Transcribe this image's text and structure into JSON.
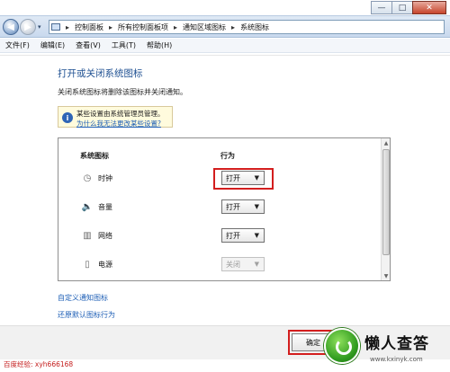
{
  "window": {
    "controls": [
      "—",
      "□",
      "✕"
    ]
  },
  "nav": {
    "address_segments": [
      "控制面板",
      "所有控制面板项",
      "通知区域图标",
      "系统图标"
    ],
    "separator": "▸"
  },
  "menu": {
    "items": [
      "文件(F)",
      "编辑(E)",
      "查看(V)",
      "工具(T)",
      "帮助(H)"
    ]
  },
  "page": {
    "title": "打开或关闭系统图标",
    "description": "关闭系统图标将删除该图标并关闭通知。",
    "notice": {
      "text": "某些设置由系统管理员管理。",
      "link": "为什么我无法更改某些设置?"
    },
    "table": {
      "col_icon": "系统图标",
      "col_behavior": "行为",
      "rows": [
        {
          "icon": "clock-icon",
          "label": "时钟",
          "value": "打开",
          "enabled": true
        },
        {
          "icon": "speaker-icon",
          "label": "音量",
          "value": "打开",
          "enabled": true
        },
        {
          "icon": "network-icon",
          "label": "网络",
          "value": "打开",
          "enabled": true
        },
        {
          "icon": "power-icon",
          "label": "电源",
          "value": "关闭",
          "enabled": false
        }
      ]
    },
    "links": {
      "customize": "自定义通知图标",
      "restore": "还原默认图标行为"
    }
  },
  "footer": {
    "ok_label": "确定"
  },
  "watermark": {
    "left_text": "百度经验: xyh666168",
    "brand": "懒人查答",
    "url": "www.kxinyk.com"
  }
}
